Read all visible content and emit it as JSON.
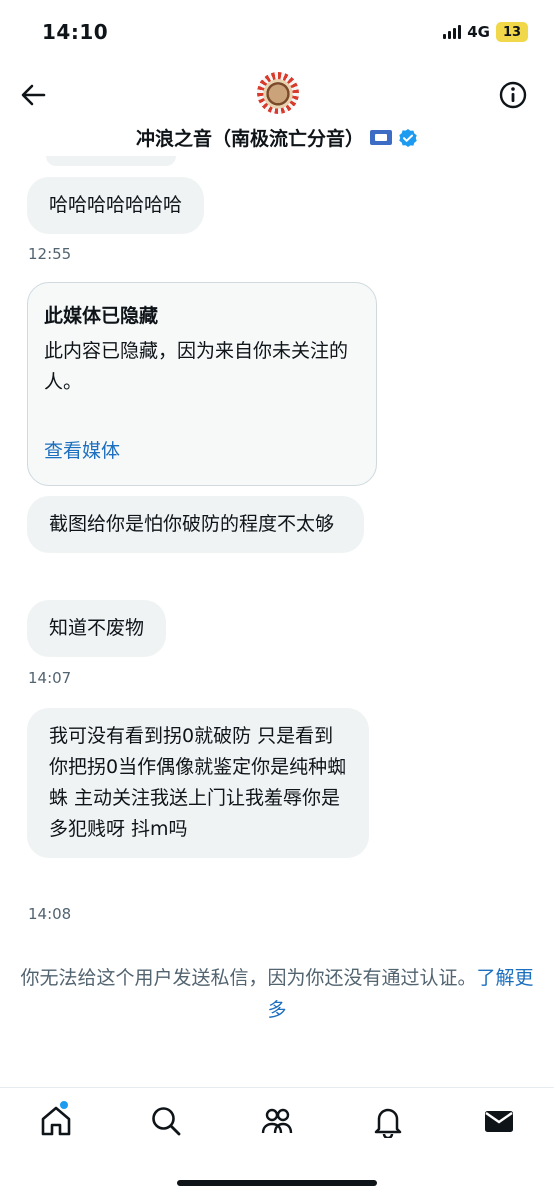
{
  "status_bar": {
    "time": "14:10",
    "network": "4G",
    "battery": "13"
  },
  "header": {
    "title": "冲浪之音（南极流亡分音）"
  },
  "messages": [
    {
      "text": "哈哈哈哈哈哈哈"
    },
    {
      "time": "12:55"
    },
    {
      "media_title": "此媒体已隐藏",
      "media_desc": "此内容已隐藏，因为来自你未关注的人。",
      "media_link": "查看媒体"
    },
    {
      "text": "截图给你是怕你破防的程度不太够"
    },
    {
      "text": "知道不废物"
    },
    {
      "time": "14:07"
    },
    {
      "text": "我可没有看到拐0就破防 只是看到你把拐0当作偶像就鉴定你是纯种蜘蛛 主动关注我送上门让我羞辱你是多犯贱呀 抖m吗"
    },
    {
      "time": "14:08"
    }
  ],
  "notice": {
    "text": "你无法给这个用户发送私信，因为你还没有通过认证。",
    "link": "了解更多"
  },
  "nav": [
    "home-icon",
    "search-icon",
    "communities-icon",
    "notifications-icon",
    "messages-icon"
  ]
}
